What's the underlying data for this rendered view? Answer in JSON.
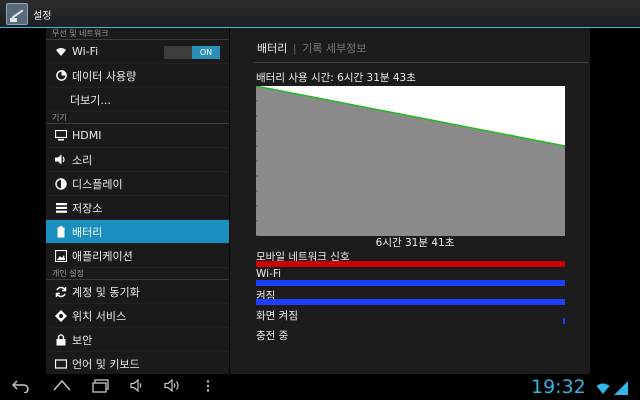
{
  "app": {
    "title": "설정"
  },
  "sidebar": {
    "sections": [
      {
        "header": "무선 및 네트워크"
      },
      {
        "header": "기기"
      },
      {
        "header": "개인 설정"
      }
    ],
    "items": [
      {
        "label": "Wi-Fi",
        "icon": "wifi-icon",
        "toggle": "ON"
      },
      {
        "label": "데이터 사용량",
        "icon": "data-usage-icon"
      },
      {
        "label": "더보기..."
      },
      {
        "label": "HDMI",
        "icon": "monitor-icon"
      },
      {
        "label": "소리",
        "icon": "speaker-icon"
      },
      {
        "label": "디스플레이",
        "icon": "brightness-icon"
      },
      {
        "label": "저장소",
        "icon": "storage-icon"
      },
      {
        "label": "배터리",
        "icon": "battery-icon",
        "selected": true
      },
      {
        "label": "애플리케이션",
        "icon": "apps-icon"
      },
      {
        "label": "계정 및 동기화",
        "icon": "sync-icon"
      },
      {
        "label": "위치 서비스",
        "icon": "location-icon"
      },
      {
        "label": "보안",
        "icon": "lock-icon"
      },
      {
        "label": "언어 및 키보드",
        "icon": "language-icon"
      }
    ]
  },
  "detail": {
    "tabs": {
      "active": "배터리",
      "separator": "|",
      "inactive": "기록 세부정보"
    },
    "usage_title": "배터리 사용 시간: 6시간 31분 43초",
    "graph_caption": "6시간 31분 41초",
    "signals": [
      {
        "label": "모바일 네트워크 신호",
        "color": "#cc0000"
      },
      {
        "label": "Wi-Fi",
        "color": "#1f3fff"
      },
      {
        "label": "켜짐",
        "color": "#1f3fff"
      },
      {
        "label": "화면 켜짐",
        "color": ""
      },
      {
        "label": "충전 중",
        "color": ""
      }
    ]
  },
  "chart_data": {
    "type": "area",
    "x": [
      0,
      1
    ],
    "values": [
      100,
      60
    ],
    "ylim": [
      0,
      100
    ],
    "title": "",
    "xlabel": "",
    "ylabel": "",
    "grid": false,
    "colors": {
      "line": "#22bb22",
      "fill": "#8a8a8a",
      "background": "#ffffff"
    }
  },
  "statusbar": {
    "time": "19:32"
  },
  "colors": {
    "accent": "#33b5e5",
    "selected": "#1a8fbf"
  }
}
